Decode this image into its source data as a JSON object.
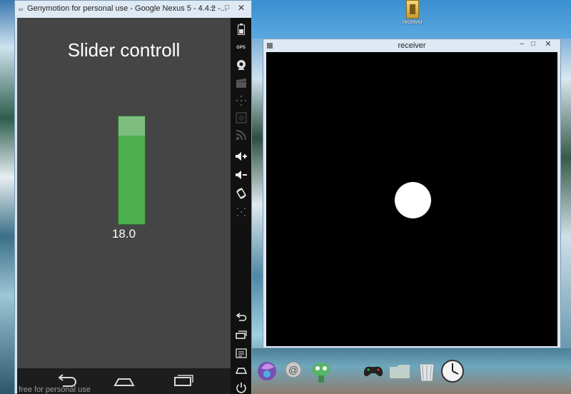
{
  "desktop": {
    "icon_label": "receiver"
  },
  "genymotion": {
    "window_title": "Genymotion for personal use - Google Nexus 5 - 4.4.2 -...",
    "screen_title": "Slider controll",
    "slider_value_text": "18.0",
    "slider_fraction": 0.82,
    "watermark": "free for personal use",
    "sidebar_gps_label": "GPS",
    "sidebar_id_label": "ID",
    "colors": {
      "screen_bg": "#454545",
      "slider_fill": "#4caf50",
      "slider_empty": "#7dbd7f"
    }
  },
  "receiver": {
    "window_title": "receiver",
    "canvas_bg": "#000000",
    "dot_color": "#ffffff"
  },
  "dock": {
    "items": [
      "launcher-icon",
      "mail-icon",
      "mascot-icon",
      "gamepad-icon",
      "folder-icon",
      "recycle-bin-icon",
      "clock-icon"
    ]
  }
}
